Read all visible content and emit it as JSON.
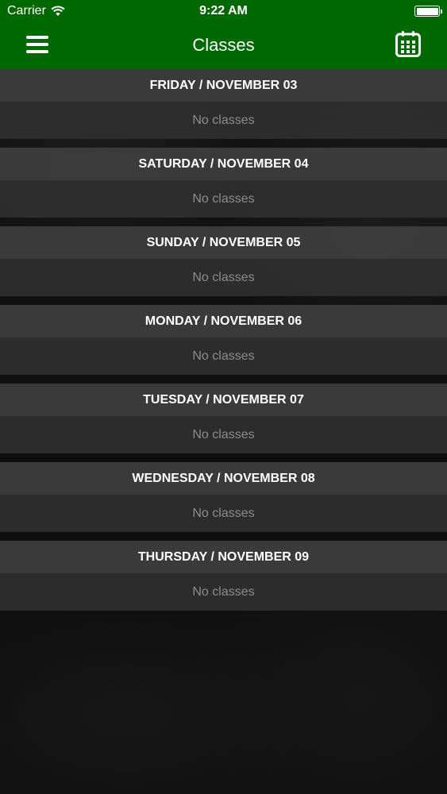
{
  "status_bar": {
    "carrier": "Carrier",
    "time": "9:22 AM",
    "icons": [
      "wifi-icon",
      "battery-icon"
    ]
  },
  "nav": {
    "title": "Classes",
    "left_icon": "hamburger-menu-icon",
    "right_icon": "calendar-icon",
    "bar_color": "#006800"
  },
  "days": [
    {
      "header": "FRIDAY / NOVEMBER 03",
      "body": "No classes"
    },
    {
      "header": "SATURDAY / NOVEMBER 04",
      "body": "No classes"
    },
    {
      "header": "SUNDAY / NOVEMBER 05",
      "body": "No classes"
    },
    {
      "header": "MONDAY / NOVEMBER 06",
      "body": "No classes"
    },
    {
      "header": "TUESDAY / NOVEMBER 07",
      "body": "No classes"
    },
    {
      "header": "WEDNESDAY / NOVEMBER 08",
      "body": "No classes"
    },
    {
      "header": "THURSDAY / NOVEMBER 09",
      "body": "No classes"
    }
  ]
}
